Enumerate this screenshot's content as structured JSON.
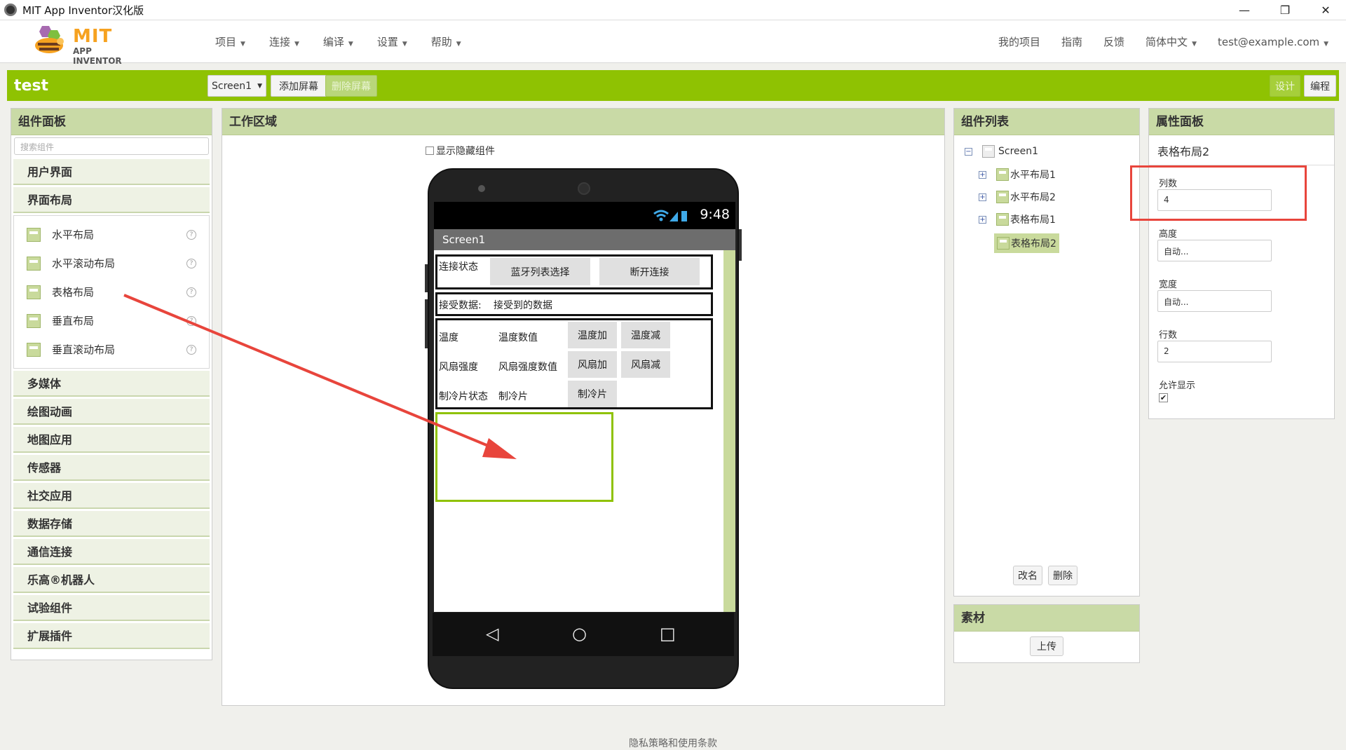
{
  "window": {
    "title": "MIT App Inventor汉化版",
    "controls": [
      "—",
      "❐",
      "✕"
    ]
  },
  "logo": {
    "mit": "MIT",
    "app_inventor": "APP INVENTOR"
  },
  "menu": {
    "left": [
      "项目",
      "连接",
      "编译",
      "设置",
      "帮助"
    ],
    "right": [
      "我的项目",
      "指南",
      "反馈",
      "简体中文",
      "test@example.com"
    ]
  },
  "toolbar": {
    "project_name": "test",
    "screen_select": "Screen1",
    "add_screen": "添加屏幕",
    "remove_screen": "删除屏幕",
    "designer": "设计",
    "blocks": "编程"
  },
  "palette": {
    "title": "组件面板",
    "search_placeholder": "搜索组件",
    "categories_top": [
      "用户界面",
      "界面布局"
    ],
    "layout_items": [
      "水平布局",
      "水平滚动布局",
      "表格布局",
      "垂直布局",
      "垂直滚动布局"
    ],
    "categories_bottom": [
      "多媒体",
      "绘图动画",
      "地图应用",
      "传感器",
      "社交应用",
      "数据存储",
      "通信连接",
      "乐高®机器人",
      "试验组件",
      "扩展插件"
    ]
  },
  "viewer": {
    "title": "工作区域",
    "show_hidden": "显示隐藏组件",
    "phone_time": "9:48",
    "screen_title": "Screen1",
    "row1": {
      "label": "连接状态",
      "btn1": "蓝牙列表选择",
      "btn2": "断开连接"
    },
    "row2": {
      "label": "接受数据:",
      "value": "接受到的数据"
    },
    "table": {
      "r1": [
        "温度",
        "温度数值",
        "温度加",
        "温度减"
      ],
      "r2": [
        "风扇强度",
        "风扇强度数值",
        "风扇加",
        "风扇减"
      ],
      "r3": [
        "制冷片状态",
        "制冷片",
        "制冷片"
      ]
    }
  },
  "components": {
    "title": "组件列表",
    "tree": [
      "Screen1",
      "水平布局1",
      "水平布局2",
      "表格布局1",
      "表格布局2"
    ],
    "rename": "改名",
    "delete": "删除"
  },
  "media": {
    "title": "素材",
    "upload": "上传"
  },
  "properties": {
    "title": "属性面板",
    "component": "表格布局2",
    "columns_label": "列数",
    "columns_value": "4",
    "height_label": "高度",
    "height_value": "自动...",
    "width_label": "宽度",
    "width_value": "自动...",
    "rows_label": "行数",
    "rows_value": "2",
    "visible_label": "允许显示",
    "visible_checked": true
  },
  "footer": "隐私策略和使用条款",
  "colors": {
    "accent_green": "#8fc202",
    "highlight_red": "#e8453c",
    "panel_header": "#c9daa6"
  }
}
